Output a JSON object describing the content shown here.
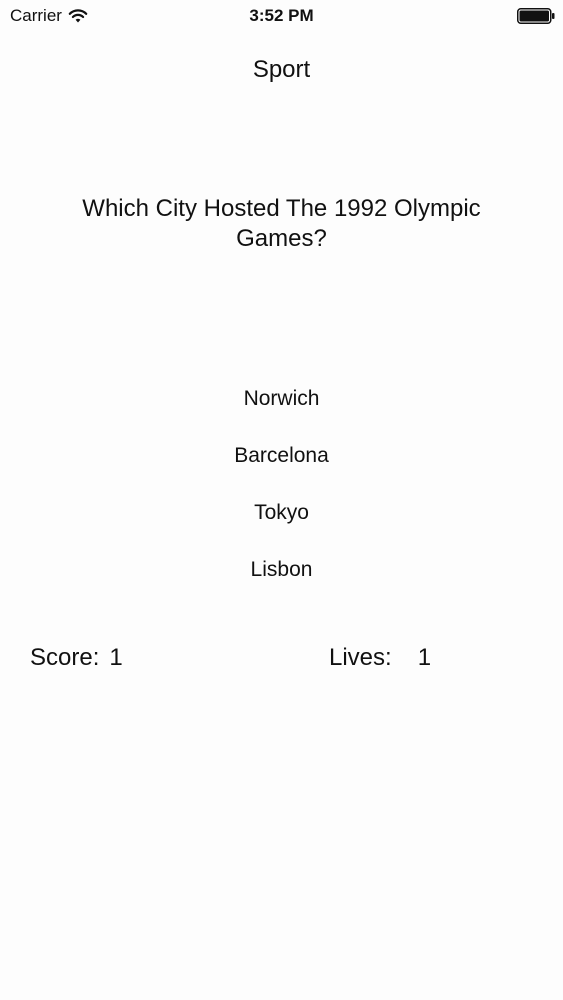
{
  "status_bar": {
    "carrier": "Carrier",
    "time": "3:52 PM",
    "wifi_icon": "wifi-icon",
    "battery_icon": "battery-full-icon"
  },
  "page": {
    "title": "Sport"
  },
  "question": {
    "text": "Which City Hosted The 1992 Olympic Games?"
  },
  "answers": [
    {
      "label": "Norwich"
    },
    {
      "label": "Barcelona"
    },
    {
      "label": "Tokyo"
    },
    {
      "label": "Lisbon"
    }
  ],
  "stats": {
    "score_label": "Score:",
    "score_value": "1",
    "lives_label": "Lives:",
    "lives_value": "1"
  }
}
